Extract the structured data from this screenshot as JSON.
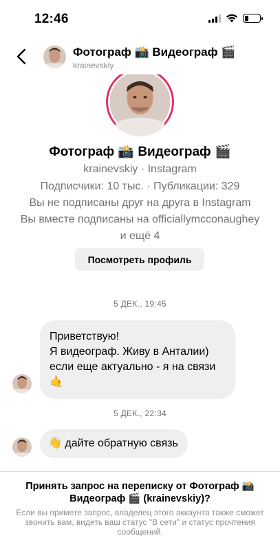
{
  "status_bar": {
    "time": "12:46"
  },
  "header": {
    "name": "Фотограф 📸 Видеограф 🎬",
    "username": "krainevskiy"
  },
  "profile": {
    "name": "Фотограф 📸 Видеограф 🎬",
    "subtitle": "krainevskiy · Instagram",
    "stats": "Подписчики: 10 тыс. · Публикации: 329",
    "follow_status": "Вы не подписаны друг на друга в Instagram",
    "mutual_line1": "Вы вместе подписаны на officiallymcconaughey",
    "mutual_line2": "и ещё 4",
    "view_profile_label": "Посмотреть профиль"
  },
  "messages": [
    {
      "timestamp": "5 ДЕК., 19:45",
      "lines": [
        "Приветствую!",
        "Я видеограф. Живу в Анталии)",
        "если еще актуально - я на связи",
        "🤙"
      ]
    },
    {
      "timestamp": "5 ДЕК., 22:34",
      "emoji": "👋",
      "text": "дайте обратную связь"
    }
  ],
  "request": {
    "title": "Принять запрос на переписку от Фотограф 📸 Видеограф 🎬 (krainevskiy)?",
    "description": "Если вы примете запрос, владелец этого аккаунта также сможет звонить вам, видеть ваш статус \"В сети\" и статус прочтения сообщений."
  },
  "icons": {
    "back": "chevron-left-icon",
    "signal": "cellular-signal-icon",
    "wifi": "wifi-icon",
    "battery": "battery-icon"
  },
  "colors": {
    "bubble": "#efefef",
    "avatar_ring": "#e1306c",
    "secondary_text": "#737373"
  }
}
